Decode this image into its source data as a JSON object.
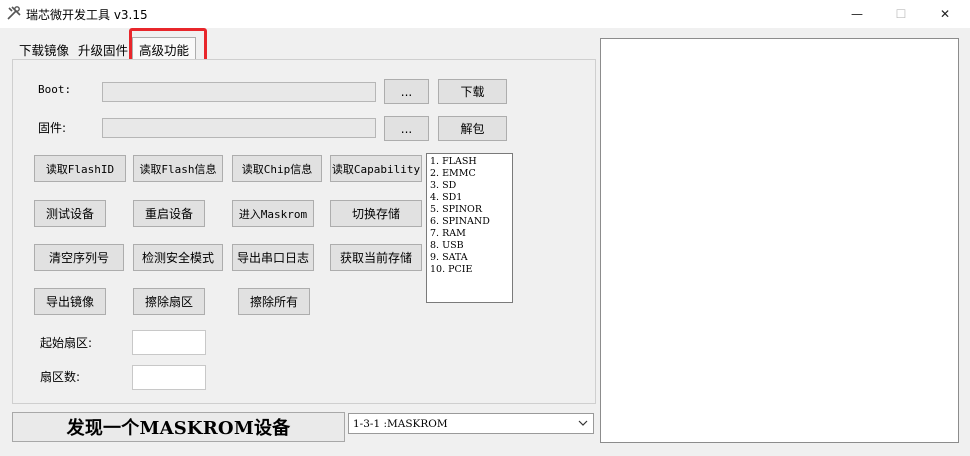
{
  "window": {
    "title": "瑞芯微开发工具 v3.15",
    "controls": {
      "minimize": "—",
      "maximize": "☐",
      "close": "✕"
    }
  },
  "tabs": [
    {
      "label": "下载镜像"
    },
    {
      "label": "升级固件"
    },
    {
      "label": "高级功能",
      "active": true
    }
  ],
  "highlight_color": "#e8262b",
  "boot_row": {
    "label": "Boot:",
    "value": "",
    "browse_label": "...",
    "action_label": "下载"
  },
  "firmware_row": {
    "label": "固件:",
    "value": "",
    "browse_label": "...",
    "action_label": "解包"
  },
  "buttons": {
    "read_flash_id": "读取FlashID",
    "read_flash_info": "读取Flash信息",
    "read_chip_info": "读取Chip信息",
    "read_capability": "读取Capability",
    "test_device": "测试设备",
    "reset_device": "重启设备",
    "enter_maskrom": "进入Maskrom",
    "switch_storage": "切换存储",
    "clear_serial": "清空序列号",
    "detect_secure_mode": "检测安全模式",
    "export_serial_log": "导出串口日志",
    "get_current_storage": "获取当前存储",
    "export_image": "导出镜像",
    "erase_sector": "擦除扇区",
    "erase_all": "擦除所有"
  },
  "storage_list": [
    "1.  FLASH",
    "2.  EMMC",
    "3.  SD",
    "4.  SD1",
    "5.  SPINOR",
    "6.  SPINAND",
    "7.  RAM",
    "8.  USB",
    "9.  SATA",
    "10.  PCIE"
  ],
  "start_sector": {
    "label": "起始扇区:",
    "value": ""
  },
  "sector_count": {
    "label": "扇区数:",
    "value": ""
  },
  "status_text": "发现一个MASKROM设备",
  "device_select": {
    "selected": "1-3-1 :MASKROM"
  },
  "log_text": ""
}
